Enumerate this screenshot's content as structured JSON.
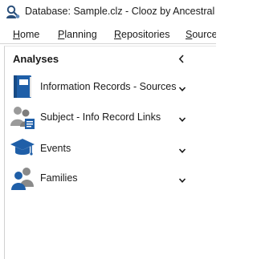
{
  "window": {
    "title": "Database: Sample.clz - Clooz by Ancestral Systems"
  },
  "menu": {
    "items": [
      {
        "label": "Home",
        "mnemonic": "H",
        "rest": "ome"
      },
      {
        "label": "Planning",
        "mnemonic": "P",
        "rest": "lanning"
      },
      {
        "label": "Repositories",
        "mnemonic": "R",
        "rest": "epositories"
      },
      {
        "label": "Sources",
        "mnemonic": "S",
        "rest": "ources"
      }
    ]
  },
  "panel": {
    "title": "Analyses",
    "items": [
      {
        "label": "Information Records  - Sources",
        "icon": "book-icon"
      },
      {
        "label": "Subject - Info Record Links",
        "icon": "people-link-icon"
      },
      {
        "label": "Events",
        "icon": "graduation-cap-icon"
      },
      {
        "label": "Families",
        "icon": "family-icon"
      }
    ]
  },
  "colors": {
    "accent_blue": "#1f5fa8",
    "icon_gray": "#8a8a8a"
  }
}
